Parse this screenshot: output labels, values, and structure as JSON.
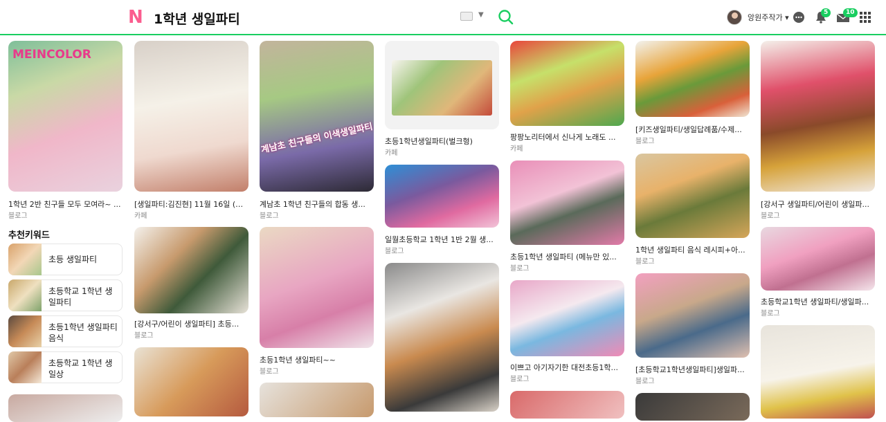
{
  "header": {
    "logo": "N",
    "query": "1학년 생일파티",
    "username": "앙원주작가",
    "badges": {
      "notifications": "5",
      "mail": "10"
    },
    "colors": {
      "accent": "#19ce60",
      "logo": "#fb5d8f"
    }
  },
  "columns": [
    {
      "cards": [
        {
          "title": "1학년 2반 친구들 모두 모여라~ ...",
          "source": "블로그"
        }
      ],
      "keywords_title": "추천키워드",
      "keywords": [
        {
          "label": "초등 생일파티"
        },
        {
          "label": "초등학교 1학년 생일파티"
        },
        {
          "label": "초등1학년 생일파티 음식"
        },
        {
          "label": "초등학교 1학년 생일상"
        }
      ]
    },
    {
      "cards": [
        {
          "title": "[생일파티:김진현] 11월 16일 (도...",
          "source": "카페"
        },
        {
          "title": "[강서구/어린이 생일파티] 초등...",
          "source": "블로그"
        }
      ]
    },
    {
      "cards": [
        {
          "title": "계남초 1학년 친구들의 합동 생...",
          "source": "블로그"
        },
        {
          "title": "초등1학년 생일파티~~",
          "source": "블로그"
        }
      ]
    },
    {
      "cards": [
        {
          "title": "초등1학년생일파티(벌크형)",
          "source": "카페"
        },
        {
          "title": "일월초등학교 1학년 1반 2월 생...",
          "source": "블로그"
        }
      ]
    },
    {
      "cards": [
        {
          "title": "팡팡노리터에서 신나게 노래도 ...",
          "source": "카페"
        },
        {
          "title": "초등1학년 생일파티 (메뉴만 있...",
          "source": "블로그"
        },
        {
          "title": "이쁘고 아기자기한 대전초등1학...",
          "source": "블로그"
        }
      ]
    },
    {
      "cards": [
        {
          "title": "[키즈생일파티/생일답례품/수제...",
          "source": "블로그"
        },
        {
          "title": "1학년 생일파티 음식 레시피+아...",
          "source": "블로그"
        },
        {
          "title": "[초등학교1학년생일파티]생일파...",
          "source": "블로그"
        }
      ]
    },
    {
      "cards": [
        {
          "title": "[강서구 생일파티/어린이 생일파...",
          "source": "블로그"
        },
        {
          "title": "초등학교1학년 생일파티/생일파...",
          "source": "블로그"
        }
      ]
    }
  ]
}
